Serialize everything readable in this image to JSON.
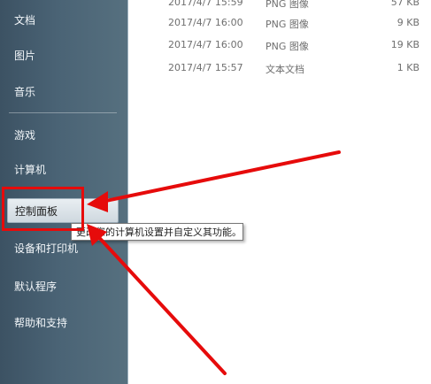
{
  "sidebar": {
    "items": [
      {
        "label": "文档"
      },
      {
        "label": "图片"
      },
      {
        "label": "音乐"
      },
      {
        "label": "游戏"
      },
      {
        "label": "计算机"
      },
      {
        "label": "控制面板"
      },
      {
        "label": "设备和打印机"
      },
      {
        "label": "默认程序"
      },
      {
        "label": "帮助和支持"
      }
    ]
  },
  "files": [
    {
      "date": "2017/4/7 15:59",
      "type": "PNG 图像",
      "size": "57 KB"
    },
    {
      "date": "2017/4/7 16:00",
      "type": "PNG 图像",
      "size": "9 KB"
    },
    {
      "date": "2017/4/7 16:00",
      "type": "PNG 图像",
      "size": "19 KB"
    },
    {
      "date": "2017/4/7 15:57",
      "type": "文本文档",
      "size": "1 KB"
    }
  ],
  "tooltip": {
    "text": "更改您的计算机设置并自定义其功能。"
  },
  "colors": {
    "annotation": "#e60b0b",
    "sidebar": "#4a6375"
  }
}
